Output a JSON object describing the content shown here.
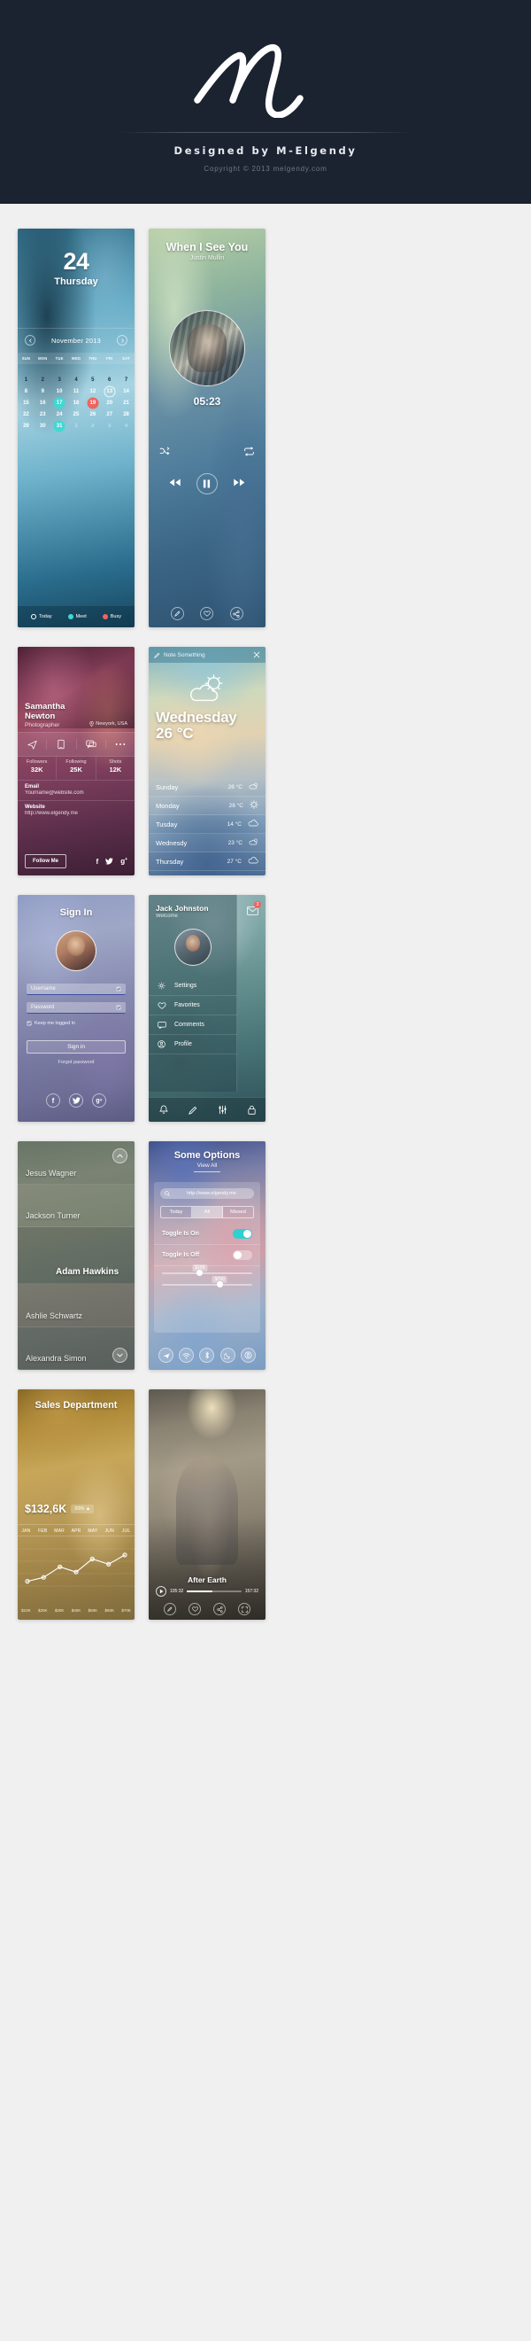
{
  "header": {
    "logo": "m-signature-logo",
    "designed_by": "Designed by M-Elgendy",
    "copyright": "Copyright © 2013 melgendy.com"
  },
  "calendar_card": {
    "day_number": "24",
    "day_name": "Thursday",
    "month_label": "November 2013",
    "prev_icon": "chevron-left-icon",
    "next_icon": "chevron-right-icon",
    "weekdays": [
      "SUN",
      "MON",
      "TUE",
      "WED",
      "THU",
      "FRI",
      "SAT"
    ],
    "weeks": [
      [
        {
          "d": "1",
          "s": "dark"
        },
        {
          "d": "2",
          "s": "dark"
        },
        {
          "d": "3",
          "s": "dark"
        },
        {
          "d": "4",
          "s": "dark"
        },
        {
          "d": "5",
          "s": "dark"
        },
        {
          "d": "6",
          "s": "dark"
        },
        {
          "d": "7",
          "s": "dark"
        }
      ],
      [
        {
          "d": "8",
          "s": ""
        },
        {
          "d": "9",
          "s": ""
        },
        {
          "d": "10",
          "s": ""
        },
        {
          "d": "11",
          "s": ""
        },
        {
          "d": "12",
          "s": ""
        },
        {
          "d": "13",
          "s": "outline"
        },
        {
          "d": "14",
          "s": ""
        }
      ],
      [
        {
          "d": "15",
          "s": ""
        },
        {
          "d": "16",
          "s": ""
        },
        {
          "d": "17",
          "s": "meet"
        },
        {
          "d": "18",
          "s": ""
        },
        {
          "d": "19",
          "s": "busy"
        },
        {
          "d": "20",
          "s": ""
        },
        {
          "d": "21",
          "s": ""
        }
      ],
      [
        {
          "d": "22",
          "s": ""
        },
        {
          "d": "23",
          "s": ""
        },
        {
          "d": "24",
          "s": ""
        },
        {
          "d": "25",
          "s": ""
        },
        {
          "d": "26",
          "s": ""
        },
        {
          "d": "27",
          "s": ""
        },
        {
          "d": "28",
          "s": ""
        }
      ],
      [
        {
          "d": "29",
          "s": ""
        },
        {
          "d": "30",
          "s": ""
        },
        {
          "d": "31",
          "s": "meet"
        },
        {
          "d": "1",
          "s": "dim"
        },
        {
          "d": "2",
          "s": "dim"
        },
        {
          "d": "3",
          "s": "dim"
        },
        {
          "d": "4",
          "s": "dim"
        }
      ]
    ],
    "legend": [
      {
        "label": "Today",
        "color": "#ffffff",
        "style": "ring"
      },
      {
        "label": "Meet",
        "color": "#3fd9d4",
        "style": "solid"
      },
      {
        "label": "Busy",
        "color": "#f2635f",
        "style": "solid"
      }
    ]
  },
  "music_card": {
    "title": "When I See You",
    "artist": "Justin Mullin",
    "elapsed": "05:23",
    "shuffle_icon": "shuffle-icon",
    "repeat_icon": "repeat-icon",
    "prev_icon": "rewind-icon",
    "play_icon": "pause-icon",
    "next_icon": "forward-icon",
    "footer_icons": [
      "edit-icon",
      "heart-icon",
      "share-icon"
    ]
  },
  "profile_card": {
    "name": "Samantha Newton",
    "role": "Photographer",
    "location": "Newyork, USA",
    "location_icon": "map-pin-icon",
    "action_icons": [
      "send-icon",
      "phone-icon",
      "chat-icon",
      "more-icon"
    ],
    "stats": [
      {
        "label": "Followers",
        "value": "32K"
      },
      {
        "label": "Following",
        "value": "25K"
      },
      {
        "label": "Shots",
        "value": "12K"
      }
    ],
    "fields": [
      {
        "label": "Email",
        "value": "Yourname@website.com"
      },
      {
        "label": "Website",
        "value": "http://www.elgendy.me"
      }
    ],
    "follow_button": "Follow Me",
    "social_icons": [
      "facebook-icon",
      "twitter-icon",
      "google-plus-icon"
    ]
  },
  "weather_card": {
    "note_placeholder": "Note Something",
    "note_icon": "compose-icon",
    "close_icon": "close-icon",
    "main_icon": "sun-cloud-icon",
    "day": "Wednesday",
    "temperature": "26 °C",
    "forecast": [
      {
        "day": "Sunday",
        "temp": "26 °C",
        "icon": "sun-cloud-icon"
      },
      {
        "day": "Monday",
        "temp": "28 °C",
        "icon": "sun-icon"
      },
      {
        "day": "Tusday",
        "temp": "14 °C",
        "icon": "cloud-icon"
      },
      {
        "day": "Wednesdy",
        "temp": "23 °C",
        "icon": "sun-cloud-icon"
      },
      {
        "day": "Thursday",
        "temp": "27 °C",
        "icon": "cloud-icon"
      }
    ]
  },
  "signin_card": {
    "title": "Sign In",
    "avatar": "user-avatar",
    "username_placeholder": "Username",
    "password_placeholder": "Password",
    "field_icon": "check-field-icon",
    "remember_label": "Keep me logged in",
    "remember_checked": true,
    "submit_label": "Sign in",
    "forgot_label": "Forgot password",
    "social_icons": [
      "facebook-icon",
      "twitter-icon",
      "google-plus-icon"
    ]
  },
  "menu_card": {
    "name": "Jack Johnston",
    "subtitle": "Welcome",
    "mail_icon": "envelope-icon",
    "mail_badge": "3",
    "avatar": "user-avatar",
    "items": [
      {
        "label": "Settings",
        "icon": "gear-icon"
      },
      {
        "label": "Favorites",
        "icon": "heart-icon"
      },
      {
        "label": "Comments",
        "icon": "comment-icon"
      },
      {
        "label": "Profile",
        "icon": "profile-icon"
      }
    ],
    "tabbar_icons": [
      "bell-icon",
      "compose-icon",
      "sliders-icon",
      "lock-icon"
    ]
  },
  "list_card": {
    "up_icon": "chevron-up-circle-icon",
    "down_icon": "chevron-down-circle-icon",
    "items": [
      {
        "name": "Jesus Wagner",
        "active": false
      },
      {
        "name": "Jackson Turner",
        "active": false
      },
      {
        "name": "Adam Hawkins",
        "active": true
      },
      {
        "name": "Ashlie Schwartz",
        "active": false
      },
      {
        "name": "Alexandra Simon",
        "active": false
      }
    ]
  },
  "options_card": {
    "title": "Some Options",
    "subtitle": "View All",
    "search_icon": "search-icon",
    "search_value": "http://www.elgendy.me",
    "segments": [
      {
        "label": "Today",
        "selected": false
      },
      {
        "label": "All",
        "selected": true
      },
      {
        "label": "Missed",
        "selected": false
      }
    ],
    "toggles": [
      {
        "label": "Toggle Is On",
        "on": true
      },
      {
        "label": "Toggle Is Off",
        "on": false
      }
    ],
    "sliders": [
      {
        "bubble": "$159",
        "pct": 42
      },
      {
        "bubble": "$750",
        "pct": 64
      }
    ],
    "bottom_icons": [
      "airplane-icon",
      "wifi-icon",
      "bluetooth-icon",
      "moon-icon",
      "rotation-lock-icon"
    ]
  },
  "sales_card": {
    "title": "Sales Department",
    "amount": "$132,6K",
    "delta": "20% ▲",
    "months": [
      "JAN",
      "FEB",
      "MAR",
      "APR",
      "MAY",
      "JUN",
      "JUL"
    ],
    "axis_labels": [
      "$10K",
      "$20K",
      "$30K",
      "$40K",
      "$50K",
      "$60K",
      "$70K"
    ]
  },
  "movie_card": {
    "title": "After Earth",
    "play_icon": "play-icon",
    "time_current": "105:32",
    "time_total": "157:32",
    "progress_pct": 47,
    "footer_icons": [
      "edit-icon",
      "heart-icon",
      "share-icon",
      "expand-icon"
    ]
  },
  "chart_data": {
    "type": "line",
    "title": "Sales Department",
    "categories": [
      "JAN",
      "FEB",
      "MAR",
      "APR",
      "MAY",
      "JUN",
      "JUL"
    ],
    "values": [
      18,
      24,
      40,
      32,
      52,
      44,
      58
    ],
    "xlabel": "",
    "ylabel": "",
    "ylim": [
      0,
      70
    ],
    "axis_ticks": [
      "$10K",
      "$20K",
      "$30K",
      "$40K",
      "$50K",
      "$60K",
      "$70K"
    ],
    "grid": true,
    "legend": false,
    "line_color": "#ffffff",
    "marker": "circle"
  }
}
